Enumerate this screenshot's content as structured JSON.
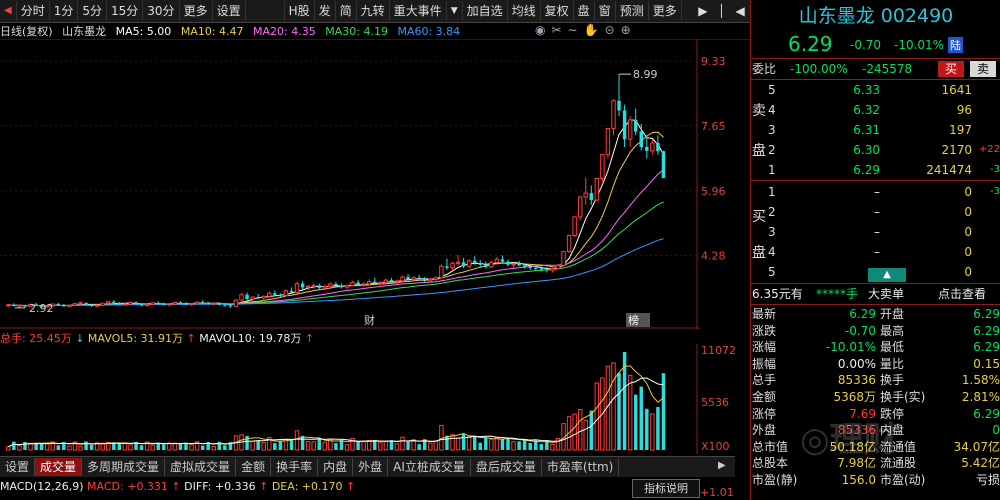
{
  "toolbar": {
    "left_items": [
      "分时",
      "1分",
      "5分",
      "15分",
      "30分",
      "更多",
      "设置"
    ],
    "mid_items": [
      "H股",
      "发",
      "简",
      "九转",
      "重大事件"
    ],
    "right_items": [
      "加自选",
      "均线",
      "复权",
      "盘",
      "窗",
      "预测",
      "更多"
    ]
  },
  "chart_header": {
    "period": "日线(复权)",
    "name": "山东墨龙",
    "ma5": "MA5: 5.00",
    "ma10": "MA10: 4.47",
    "ma20": "MA20: 4.35",
    "ma30": "MA30: 4.19",
    "ma60": "MA60: 3.84"
  },
  "colors": {
    "up": "#ff3b3b",
    "down": "#26e0e0",
    "ma5": "#ffffff",
    "ma10": "#e8d040",
    "ma20": "#ff66ff",
    "ma30": "#33dd55",
    "ma60": "#3399ff",
    "accent_border": "#8b1a1a"
  },
  "main_chart": {
    "price_labels": [
      "9.33",
      "7.65",
      "5.96",
      "4.28"
    ],
    "high_label": "8.99",
    "low_label": "2.92",
    "marker_cai": "财",
    "marker_bang": "榜"
  },
  "chart_data": {
    "type": "candlestick",
    "ylim": [
      2.5,
      9.8
    ],
    "ohlc": [
      [
        2.98,
        3.02,
        2.94,
        3.0
      ],
      [
        3.0,
        3.04,
        2.95,
        2.97
      ],
      [
        2.97,
        3.01,
        2.93,
        2.99
      ],
      [
        2.99,
        3.0,
        2.92,
        2.95
      ],
      [
        2.95,
        3.02,
        2.94,
        3.01
      ],
      [
        3.01,
        3.05,
        2.97,
        2.98
      ],
      [
        2.98,
        3.0,
        2.92,
        2.94
      ],
      [
        2.94,
        2.99,
        2.92,
        2.97
      ],
      [
        2.97,
        3.03,
        2.95,
        3.02
      ],
      [
        3.02,
        3.05,
        2.98,
        3.0
      ],
      [
        3.0,
        3.02,
        2.95,
        2.96
      ],
      [
        2.96,
        3.0,
        2.93,
        2.99
      ],
      [
        2.99,
        3.04,
        2.97,
        3.03
      ],
      [
        3.03,
        3.08,
        3.0,
        3.05
      ],
      [
        3.05,
        3.06,
        2.98,
        3.0
      ],
      [
        3.0,
        3.02,
        2.94,
        2.97
      ],
      [
        2.97,
        3.01,
        2.93,
        2.99
      ],
      [
        2.99,
        3.05,
        2.97,
        3.04
      ],
      [
        3.04,
        3.1,
        3.01,
        3.08
      ],
      [
        3.08,
        3.12,
        3.02,
        3.05
      ],
      [
        3.05,
        3.07,
        2.99,
        3.01
      ],
      [
        3.01,
        3.04,
        2.97,
        3.02
      ],
      [
        3.02,
        3.08,
        3.0,
        3.06
      ],
      [
        3.06,
        3.09,
        3.01,
        3.03
      ],
      [
        3.03,
        3.05,
        2.96,
        2.98
      ],
      [
        2.98,
        3.03,
        2.95,
        3.01
      ],
      [
        3.01,
        3.07,
        2.99,
        3.05
      ],
      [
        3.05,
        3.09,
        3.01,
        3.03
      ],
      [
        3.03,
        3.06,
        2.98,
        3.0
      ],
      [
        3.0,
        3.04,
        2.96,
        3.02
      ],
      [
        3.02,
        3.08,
        3.0,
        3.06
      ],
      [
        3.06,
        3.1,
        3.02,
        3.04
      ],
      [
        3.04,
        3.07,
        2.99,
        3.01
      ],
      [
        3.01,
        3.05,
        2.97,
        3.03
      ],
      [
        3.03,
        3.09,
        3.01,
        3.07
      ],
      [
        3.07,
        3.12,
        3.03,
        3.05
      ],
      [
        3.05,
        3.08,
        3.0,
        3.02
      ],
      [
        3.02,
        3.06,
        2.98,
        3.04
      ],
      [
        3.04,
        3.07,
        2.99,
        3.0
      ],
      [
        3.0,
        3.03,
        2.95,
        2.98
      ],
      [
        2.98,
        3.02,
        2.92,
        2.96
      ],
      [
        2.96,
        3.15,
        2.95,
        3.12
      ],
      [
        3.12,
        3.3,
        3.08,
        3.26
      ],
      [
        3.26,
        3.32,
        3.1,
        3.15
      ],
      [
        3.15,
        3.22,
        3.08,
        3.2
      ],
      [
        3.2,
        3.28,
        3.14,
        3.18
      ],
      [
        3.18,
        3.24,
        3.1,
        3.22
      ],
      [
        3.22,
        3.35,
        3.18,
        3.3
      ],
      [
        3.3,
        3.38,
        3.22,
        3.26
      ],
      [
        3.26,
        3.3,
        3.18,
        3.24
      ],
      [
        3.24,
        3.4,
        3.22,
        3.36
      ],
      [
        3.36,
        3.45,
        3.28,
        3.32
      ],
      [
        3.32,
        3.6,
        3.3,
        3.55
      ],
      [
        3.55,
        3.62,
        3.4,
        3.45
      ],
      [
        3.45,
        3.52,
        3.38,
        3.48
      ],
      [
        3.48,
        3.56,
        3.42,
        3.5
      ],
      [
        3.5,
        3.55,
        3.4,
        3.44
      ],
      [
        3.44,
        3.52,
        3.38,
        3.48
      ],
      [
        3.48,
        3.58,
        3.44,
        3.54
      ],
      [
        3.54,
        3.6,
        3.46,
        3.5
      ],
      [
        3.5,
        3.56,
        3.42,
        3.46
      ],
      [
        3.46,
        3.52,
        3.4,
        3.5
      ],
      [
        3.5,
        3.62,
        3.48,
        3.58
      ],
      [
        3.58,
        3.64,
        3.48,
        3.52
      ],
      [
        3.52,
        3.58,
        3.46,
        3.54
      ],
      [
        3.54,
        3.66,
        3.5,
        3.6
      ],
      [
        3.6,
        3.7,
        3.54,
        3.56
      ],
      [
        3.56,
        3.62,
        3.5,
        3.58
      ],
      [
        3.58,
        3.68,
        3.56,
        3.64
      ],
      [
        3.64,
        3.7,
        3.56,
        3.6
      ],
      [
        3.6,
        3.66,
        3.54,
        3.62
      ],
      [
        3.62,
        3.76,
        3.6,
        3.72
      ],
      [
        3.72,
        3.8,
        3.62,
        3.66
      ],
      [
        3.66,
        3.74,
        3.6,
        3.7
      ],
      [
        3.7,
        3.78,
        3.64,
        3.68
      ],
      [
        3.68,
        3.72,
        3.58,
        3.62
      ],
      [
        3.62,
        3.7,
        3.58,
        3.66
      ],
      [
        3.66,
        3.74,
        3.62,
        3.7
      ],
      [
        3.7,
        4.05,
        3.68,
        4.0
      ],
      [
        4.0,
        4.2,
        3.9,
        3.96
      ],
      [
        3.96,
        4.12,
        3.88,
        4.08
      ],
      [
        4.08,
        4.3,
        4.02,
        4.1
      ],
      [
        4.1,
        4.22,
        3.95,
        4.0
      ],
      [
        4.0,
        4.18,
        3.96,
        4.14
      ],
      [
        4.14,
        4.26,
        4.04,
        4.08
      ],
      [
        4.08,
        4.16,
        3.98,
        4.04
      ],
      [
        4.04,
        4.12,
        3.94,
        3.98
      ],
      [
        3.98,
        4.14,
        3.96,
        4.1
      ],
      [
        4.1,
        4.24,
        4.06,
        4.18
      ],
      [
        4.18,
        4.28,
        4.08,
        4.12
      ],
      [
        4.12,
        4.18,
        4.0,
        4.04
      ],
      [
        4.04,
        4.1,
        3.96,
        4.06
      ],
      [
        4.06,
        4.14,
        4.0,
        4.02
      ],
      [
        4.02,
        4.08,
        3.94,
        3.98
      ],
      [
        3.98,
        4.04,
        3.9,
        3.96
      ],
      [
        3.96,
        4.02,
        3.88,
        3.94
      ],
      [
        3.94,
        4.0,
        3.86,
        3.92
      ],
      [
        3.92,
        3.98,
        3.84,
        3.9
      ],
      [
        3.9,
        3.96,
        3.84,
        3.94
      ],
      [
        3.94,
        4.06,
        3.92,
        4.02
      ],
      [
        4.02,
        4.4,
        4.0,
        4.38
      ],
      [
        4.38,
        4.82,
        4.34,
        4.8
      ],
      [
        4.8,
        5.3,
        4.76,
        5.28
      ],
      [
        5.28,
        5.82,
        5.2,
        5.8
      ],
      [
        5.8,
        6.3,
        5.6,
        5.9
      ],
      [
        5.9,
        6.1,
        5.6,
        5.72
      ],
      [
        5.72,
        6.3,
        5.7,
        6.28
      ],
      [
        6.28,
        6.92,
        6.2,
        6.9
      ],
      [
        6.9,
        7.59,
        6.8,
        7.58
      ],
      [
        7.58,
        8.34,
        7.4,
        8.3
      ],
      [
        8.3,
        8.99,
        7.9,
        8.05
      ],
      [
        8.05,
        8.2,
        7.1,
        7.3
      ],
      [
        7.3,
        7.9,
        7.1,
        7.8
      ],
      [
        7.8,
        8.1,
        7.4,
        7.5
      ],
      [
        7.5,
        7.7,
        7.0,
        7.1
      ],
      [
        7.1,
        7.4,
        6.8,
        7.0
      ],
      [
        7.0,
        7.3,
        6.9,
        7.2
      ],
      [
        7.2,
        7.4,
        6.9,
        6.99
      ],
      [
        6.99,
        7.0,
        6.29,
        6.29
      ]
    ]
  },
  "volume": {
    "header_total": "总手: 25.45万",
    "header_mavol5": "MAVOL5: 31.91万",
    "header_mavol10": "MAVOL10: 19.78万",
    "axis_top": "11072",
    "axis_mid": "5536",
    "axis_unit": "X100"
  },
  "tabs": [
    "设置",
    "成交量",
    "多周期成交量",
    "虚拟成交量",
    "金额",
    "换手率",
    "内盘",
    "外盘",
    "AI立桩成交量",
    "盘后成交量",
    "市盈率(ttm)"
  ],
  "macd": {
    "label": "MACD(12,26,9)",
    "macd": "MACD: +0.331",
    "diff": "DIFF: +0.336",
    "dea": "DEA: +0.170",
    "help": "指标说明",
    "axis": "+1.01"
  },
  "right_panel": {
    "title": "山东墨龙 002490",
    "price": "6.29",
    "change": "-0.70",
    "pct": "-10.01%",
    "tag": "陆",
    "weibi_label": "委比",
    "weibi_value": "-100.00%",
    "weicha_value": "-245578",
    "buy_btn": "买",
    "sell_btn": "卖",
    "sell_levels": [
      {
        "lvl": "5",
        "price": "6.33",
        "vol": "1641",
        "chg": ""
      },
      {
        "lvl": "4",
        "price": "6.32",
        "vol": "96",
        "chg": ""
      },
      {
        "lvl": "3",
        "price": "6.31",
        "vol": "197",
        "chg": ""
      },
      {
        "lvl": "2",
        "price": "6.30",
        "vol": "2170",
        "chg": "+22"
      },
      {
        "lvl": "1",
        "price": "6.29",
        "vol": "241474",
        "chg": "-3"
      }
    ],
    "buy_levels": [
      {
        "lvl": "1",
        "price": "–",
        "vol": "0",
        "chg": "-3"
      },
      {
        "lvl": "2",
        "price": "–",
        "vol": "0",
        "chg": ""
      },
      {
        "lvl": "3",
        "price": "–",
        "vol": "0",
        "chg": ""
      },
      {
        "lvl": "4",
        "price": "–",
        "vol": "0",
        "chg": ""
      },
      {
        "lvl": "5",
        "price": "–",
        "vol": "0",
        "chg": ""
      }
    ],
    "sell_side_label_1": "卖",
    "sell_side_label_2": "盘",
    "buy_side_label_1": "买",
    "buy_side_label_2": "盘",
    "info_price": "6.35元有",
    "info_stars": "*****手",
    "info_big": "大卖单",
    "info_click": "点击查看",
    "stats_left": [
      {
        "k": "最新",
        "v": "6.29",
        "c": "green"
      },
      {
        "k": "涨跌",
        "v": "-0.70",
        "c": "green"
      },
      {
        "k": "涨幅",
        "v": "-10.01%",
        "c": "green"
      },
      {
        "k": "振幅",
        "v": "0.00%",
        "c": "white"
      },
      {
        "k": "总手",
        "v": "85336",
        "c": "yellow"
      },
      {
        "k": "金额",
        "v": "5368万",
        "c": "yellow"
      },
      {
        "k": "涨停",
        "v": "7.69",
        "c": "red"
      },
      {
        "k": "外盘",
        "v": "85336",
        "c": "red"
      },
      {
        "k": "总市值",
        "v": "50.18亿",
        "c": "yellow"
      },
      {
        "k": "总股本",
        "v": "7.98亿",
        "c": "yellow"
      },
      {
        "k": "市盈(静)",
        "v": "156.0",
        "c": "yellow"
      }
    ],
    "stats_right": [
      {
        "k": "开盘",
        "v": "6.29",
        "c": "green"
      },
      {
        "k": "最高",
        "v": "6.29",
        "c": "green"
      },
      {
        "k": "最低",
        "v": "6.29",
        "c": "green"
      },
      {
        "k": "量比",
        "v": "0.15",
        "c": "yellow"
      },
      {
        "k": "换手",
        "v": "1.58%",
        "c": "yellow"
      },
      {
        "k": "换手(实)",
        "v": "2.81%",
        "c": "yellow"
      },
      {
        "k": "跌停",
        "v": "6.29",
        "c": "green"
      },
      {
        "k": "内盘",
        "v": "0",
        "c": "green"
      },
      {
        "k": "流通值",
        "v": "34.07亿",
        "c": "yellow"
      },
      {
        "k": "流通股",
        "v": "5.42亿",
        "c": "yellow"
      },
      {
        "k": "市盈(动)",
        "v": "亏损",
        "c": "white"
      }
    ]
  }
}
